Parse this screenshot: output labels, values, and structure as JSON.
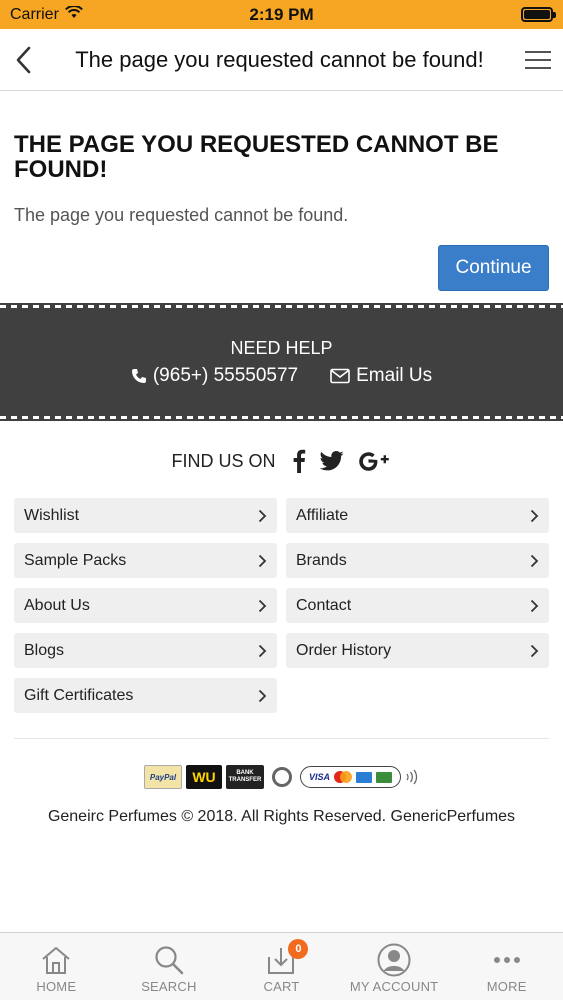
{
  "status_bar": {
    "carrier": "Carrier",
    "time": "2:19 PM",
    "battery_level": 1.0
  },
  "nav": {
    "title": "The page you requested cannot be found!"
  },
  "main": {
    "heading": "THE PAGE YOU REQUESTED CANNOT BE FOUND!",
    "message": "The page you requested cannot be found.",
    "continue_label": "Continue"
  },
  "help": {
    "title": "NEED HELP",
    "phone": "(965+) 55550577",
    "email_label": "Email Us"
  },
  "social": {
    "label": "FIND US ON",
    "icons": [
      "facebook-icon",
      "twitter-icon",
      "google-plus-icon"
    ]
  },
  "links": [
    {
      "label": "Wishlist"
    },
    {
      "label": "Affiliate"
    },
    {
      "label": "Sample Packs"
    },
    {
      "label": "Brands"
    },
    {
      "label": "About Us"
    },
    {
      "label": "Contact"
    },
    {
      "label": "Blogs"
    },
    {
      "label": "Order History"
    },
    {
      "label": "Gift Certificates"
    }
  ],
  "payments": {
    "paypal": "PayPal",
    "wu": "WU",
    "bank": "BANK TRANSFER",
    "visa": "VISA"
  },
  "footer": {
    "copyright": "Geneirc Perfumes © 2018. All Rights Reserved. GenericPerfumes"
  },
  "tabs": [
    {
      "label": "HOME",
      "icon": "home-icon"
    },
    {
      "label": "SEARCH",
      "icon": "search-icon"
    },
    {
      "label": "CART",
      "icon": "cart-icon",
      "badge": "0"
    },
    {
      "label": "MY ACCOUNT",
      "icon": "account-icon"
    },
    {
      "label": "MORE",
      "icon": "more-icon"
    }
  ],
  "colors": {
    "status_bar": "#f6a623",
    "accent": "#3a7dc9",
    "help_band": "#404040",
    "badge": "#f26a1e"
  }
}
